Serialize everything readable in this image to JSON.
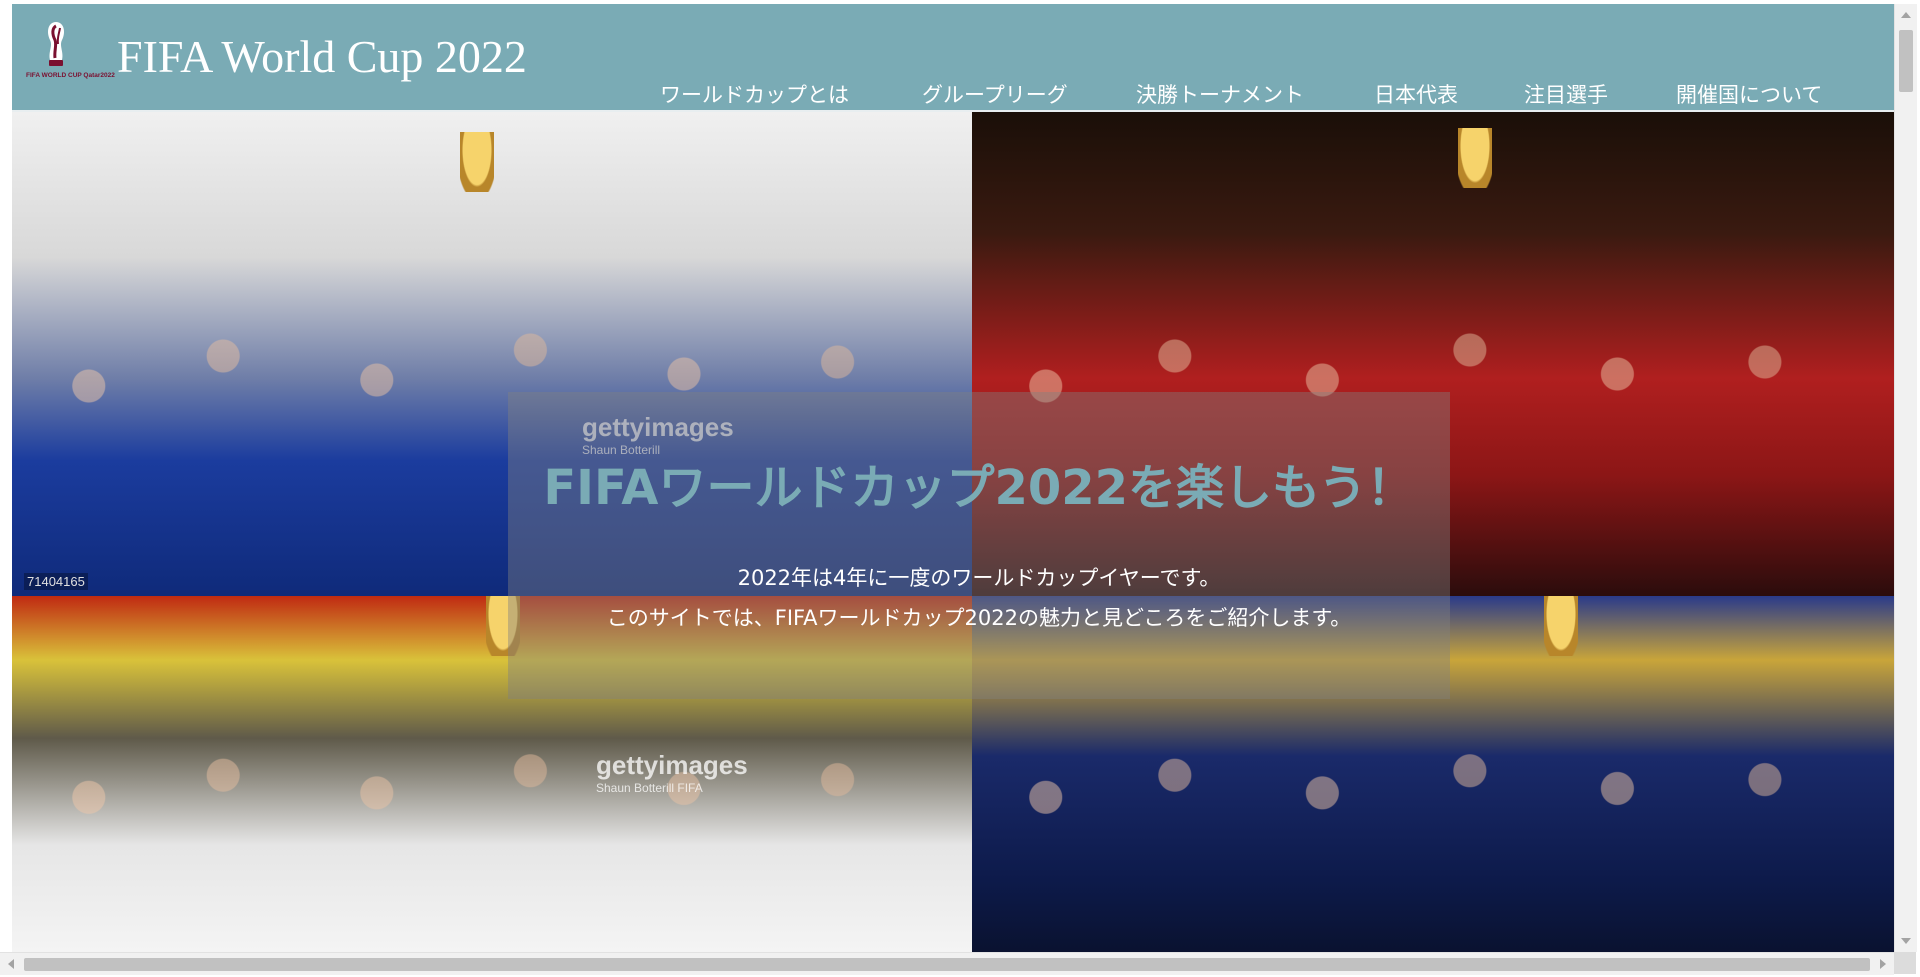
{
  "site": {
    "title": "FIFA World Cup 2022",
    "logo_text": "FIFA WORLD CUP Qatar2022",
    "brand_color": "#7aabb5"
  },
  "nav": {
    "items": [
      {
        "label": "ワールドカップとは"
      },
      {
        "label": "グループリーグ"
      },
      {
        "label": "決勝トーナメント"
      },
      {
        "label": "日本代表"
      },
      {
        "label": "注目選手"
      },
      {
        "label": "開催国について"
      }
    ]
  },
  "hero": {
    "headline": "FIFAワールドカップ2022を楽しもう！",
    "description_line1": "2022年は4年に一度のワールドカップイヤーです。",
    "description_line2": "このサイトでは、FIFAワールドカップ2022の魅力と見どころをご紹介します。",
    "photos": [
      {
        "watermark": "gettyimages",
        "credit": "Shaun Botterill",
        "photo_id": "71404165"
      },
      {
        "watermark": "",
        "credit": "",
        "photo_id": ""
      },
      {
        "watermark": "gettyimages",
        "credit": "Shaun Botterill    FIFA",
        "photo_id": ""
      },
      {
        "watermark": "",
        "credit": "",
        "photo_id": ""
      }
    ]
  }
}
